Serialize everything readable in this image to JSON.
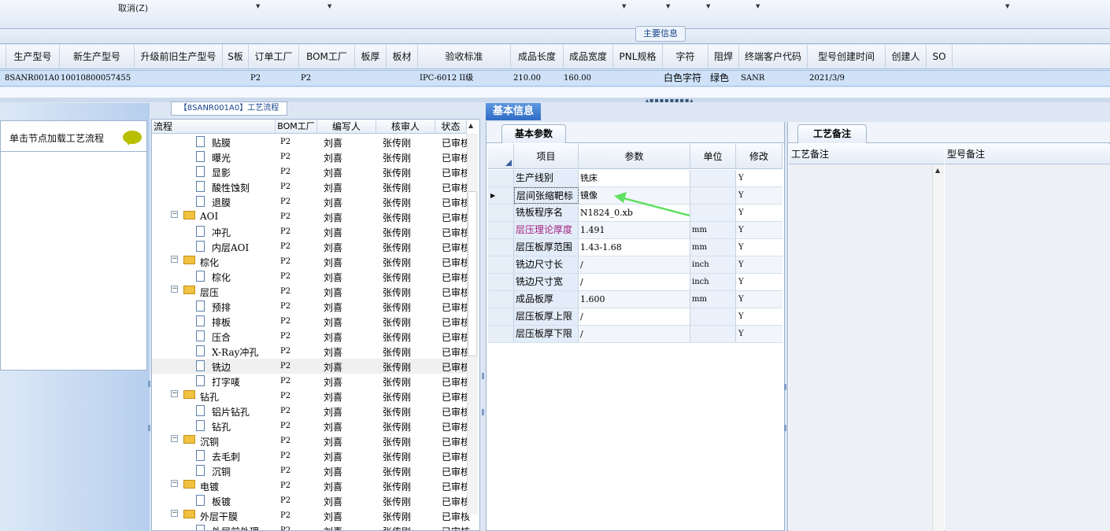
{
  "toolbar": {
    "cancel_label": "取消(Z)"
  },
  "main_info": {
    "title": "主要信息",
    "columns": [
      "生产型号",
      "新生产型号",
      "升级前旧生产型号",
      "S板",
      "订单工厂",
      "BOM工厂",
      "板厚",
      "板材",
      "验收标准",
      "成品长度",
      "成品宽度",
      "PNL规格",
      "字符",
      "阻焊",
      "终端客户代码",
      "型号创建时间",
      "创建人",
      "SO"
    ],
    "row": {
      "prod_model": "8SANR001A0",
      "new_prod_model": "10010800057455",
      "order_factory": "P2",
      "bom_factory": "P2",
      "acceptance": "IPC-6012 II级",
      "length": "210.00",
      "width": "160.00",
      "char": "白色字符",
      "mask": "绿色",
      "customer": "SANR",
      "created": "2021/3/9"
    }
  },
  "left_panel": {
    "load_label": "单击节点加载工艺流程"
  },
  "process": {
    "title": "【8SANR001A0】工艺流程",
    "headers": [
      "流程",
      "BOM工厂",
      "编写人",
      "核审人",
      "状态"
    ],
    "rows": [
      {
        "name": "贴膜",
        "type": "doc",
        "bom": "P2",
        "writer": "刘喜",
        "reviewer": "张传刚",
        "status": "已审核"
      },
      {
        "name": "曝光",
        "type": "doc",
        "bom": "P2",
        "writer": "刘喜",
        "reviewer": "张传刚",
        "status": "已审核"
      },
      {
        "name": "显影",
        "type": "doc",
        "bom": "P2",
        "writer": "刘喜",
        "reviewer": "张传刚",
        "status": "已审核"
      },
      {
        "name": "酸性蚀刻",
        "type": "doc",
        "bom": "P2",
        "writer": "刘喜",
        "reviewer": "张传刚",
        "status": "已审核"
      },
      {
        "name": "退膜",
        "type": "doc",
        "bom": "P2",
        "writer": "刘喜",
        "reviewer": "张传刚",
        "status": "已审核"
      },
      {
        "name": "AOI",
        "type": "folder",
        "bom": "P2",
        "writer": "刘喜",
        "reviewer": "张传刚",
        "status": "已审核"
      },
      {
        "name": "冲孔",
        "type": "doc",
        "bom": "P2",
        "writer": "刘喜",
        "reviewer": "张传刚",
        "status": "已审核"
      },
      {
        "name": "内层AOI",
        "type": "doc",
        "bom": "P2",
        "writer": "刘喜",
        "reviewer": "张传刚",
        "status": "已审核"
      },
      {
        "name": "棕化",
        "type": "folder",
        "bom": "P2",
        "writer": "刘喜",
        "reviewer": "张传刚",
        "status": "已审核"
      },
      {
        "name": "棕化",
        "type": "doc",
        "bom": "P2",
        "writer": "刘喜",
        "reviewer": "张传刚",
        "status": "已审核"
      },
      {
        "name": "层压",
        "type": "folder",
        "bom": "P2",
        "writer": "刘喜",
        "reviewer": "张传刚",
        "status": "已审核"
      },
      {
        "name": "预排",
        "type": "doc",
        "bom": "P2",
        "writer": "刘喜",
        "reviewer": "张传刚",
        "status": "已审核"
      },
      {
        "name": "排板",
        "type": "doc",
        "bom": "P2",
        "writer": "刘喜",
        "reviewer": "张传刚",
        "status": "已审核"
      },
      {
        "name": "压合",
        "type": "doc",
        "bom": "P2",
        "writer": "刘喜",
        "reviewer": "张传刚",
        "status": "已审核"
      },
      {
        "name": "X-Ray冲孔",
        "type": "doc",
        "bom": "P2",
        "writer": "刘喜",
        "reviewer": "张传刚",
        "status": "已审核"
      },
      {
        "name": "铣边",
        "type": "doc",
        "bom": "P2",
        "writer": "刘喜",
        "reviewer": "张传刚",
        "status": "已审核",
        "selected": true
      },
      {
        "name": "打字唛",
        "type": "doc",
        "bom": "P2",
        "writer": "刘喜",
        "reviewer": "张传刚",
        "status": "已审核"
      },
      {
        "name": "钻孔",
        "type": "folder",
        "bom": "P2",
        "writer": "刘喜",
        "reviewer": "张传刚",
        "status": "已审核"
      },
      {
        "name": "铝片钻孔",
        "type": "doc",
        "bom": "P2",
        "writer": "刘喜",
        "reviewer": "张传刚",
        "status": "已审核"
      },
      {
        "name": "钻孔",
        "type": "doc",
        "bom": "P2",
        "writer": "刘喜",
        "reviewer": "张传刚",
        "status": "已审核"
      },
      {
        "name": "沉铜",
        "type": "folder",
        "bom": "P2",
        "writer": "刘喜",
        "reviewer": "张传刚",
        "status": "已审核"
      },
      {
        "name": "去毛刺",
        "type": "doc",
        "bom": "P2",
        "writer": "刘喜",
        "reviewer": "张传刚",
        "status": "已审核"
      },
      {
        "name": "沉铜",
        "type": "doc",
        "bom": "P2",
        "writer": "刘喜",
        "reviewer": "张传刚",
        "status": "已审核"
      },
      {
        "name": "电镀",
        "type": "folder",
        "bom": "P2",
        "writer": "刘喜",
        "reviewer": "张传刚",
        "status": "已审核"
      },
      {
        "name": "板镀",
        "type": "doc",
        "bom": "P2",
        "writer": "刘喜",
        "reviewer": "张传刚",
        "status": "已审核"
      },
      {
        "name": "外层干膜",
        "type": "folder",
        "bom": "P2",
        "writer": "刘喜",
        "reviewer": "张传刚",
        "status": "已审核"
      },
      {
        "name": "外层前处理",
        "type": "doc",
        "bom": "P2",
        "writer": "刘喜",
        "reviewer": "张传刚",
        "status": "已审核"
      }
    ]
  },
  "basic_info": {
    "tab": "基本信息",
    "sub_tab": "基本参数",
    "headers": [
      "项目",
      "参数",
      "单位",
      "修改"
    ],
    "rows": [
      {
        "item": "生产线别",
        "value": "铣床",
        "unit": "",
        "mod": "Y"
      },
      {
        "item": "层间张缩靶标",
        "value": "镜像",
        "unit": "",
        "mod": "Y",
        "current": true
      },
      {
        "item": "铣板程序名",
        "value": "N1824_0.xb",
        "unit": "",
        "mod": "Y"
      },
      {
        "item": "层压理论厚度",
        "value": "1.491",
        "unit": "mm",
        "mod": "Y",
        "highlight": true
      },
      {
        "item": "层压板厚范围",
        "value": "1.43-1.68",
        "unit": "mm",
        "mod": "Y"
      },
      {
        "item": "铣边尺寸长",
        "value": "/",
        "unit": "inch",
        "mod": "Y"
      },
      {
        "item": "铣边尺寸宽",
        "value": "/",
        "unit": "inch",
        "mod": "Y"
      },
      {
        "item": "成品板厚",
        "value": "1.600",
        "unit": "mm",
        "mod": "Y"
      },
      {
        "item": "层压板厚上限",
        "value": "/",
        "unit": "",
        "mod": "Y"
      },
      {
        "item": "层压板厚下限",
        "value": "/",
        "unit": "",
        "mod": "Y"
      }
    ],
    "colors": {
      "highlight_text": "#a3217f",
      "tab_blue": "#2f6cc6",
      "arrow_green": "#62e063"
    }
  },
  "remarks": {
    "tab": "工艺备注",
    "col1": "工艺备注",
    "col2": "型号备注"
  }
}
